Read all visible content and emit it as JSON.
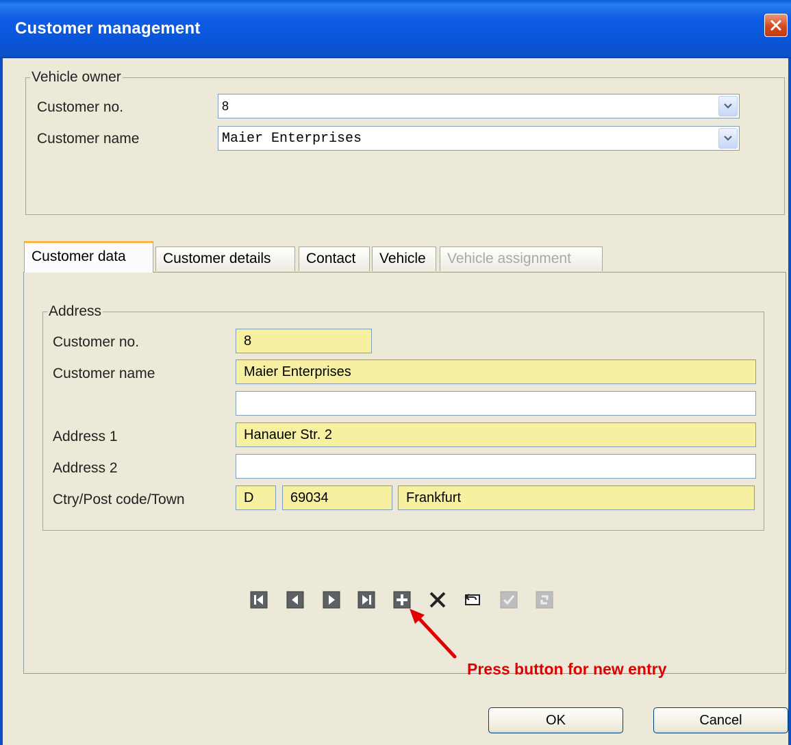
{
  "window": {
    "title": "Customer management",
    "accent": "#0a55d9",
    "close_color": "#d44a1f"
  },
  "vehicle_owner": {
    "legend": "Vehicle owner",
    "customer_no_label": "Customer no.",
    "customer_no_value": "8",
    "customer_name_label": "Customer name",
    "customer_name_value": "Maier Enterprises"
  },
  "tabs": [
    {
      "label": "Customer data",
      "state": "active"
    },
    {
      "label": "Customer details",
      "state": "normal"
    },
    {
      "label": "Contact",
      "state": "normal"
    },
    {
      "label": "Vehicle",
      "state": "normal"
    },
    {
      "label": "Vehicle assignment",
      "state": "disabled"
    }
  ],
  "address": {
    "legend": "Address",
    "customer_no_label": "Customer no.",
    "customer_no_value": "8",
    "customer_name_label": "Customer name",
    "customer_name_value": "Maier Enterprises",
    "customer_name2_value": "",
    "address1_label": "Address 1",
    "address1_value": "Hanauer Str. 2",
    "address2_label": "Address 2",
    "address2_value": "",
    "ctry_label": "Ctry/Post code/Town",
    "country_value": "D",
    "postcode_value": "69034",
    "town_value": "Frankfurt",
    "required_field_color": "#f7f0a1"
  },
  "navigator": {
    "buttons": [
      "first-record-icon",
      "previous-record-icon",
      "next-record-icon",
      "last-record-icon",
      "add-record-icon",
      "delete-record-icon",
      "undo-icon",
      "confirm-icon",
      "refresh-icon"
    ]
  },
  "annotation": {
    "text": "Press button for new entry",
    "color": "#e00000"
  },
  "buttons": {
    "ok_label": "OK",
    "cancel_label": "Cancel"
  }
}
